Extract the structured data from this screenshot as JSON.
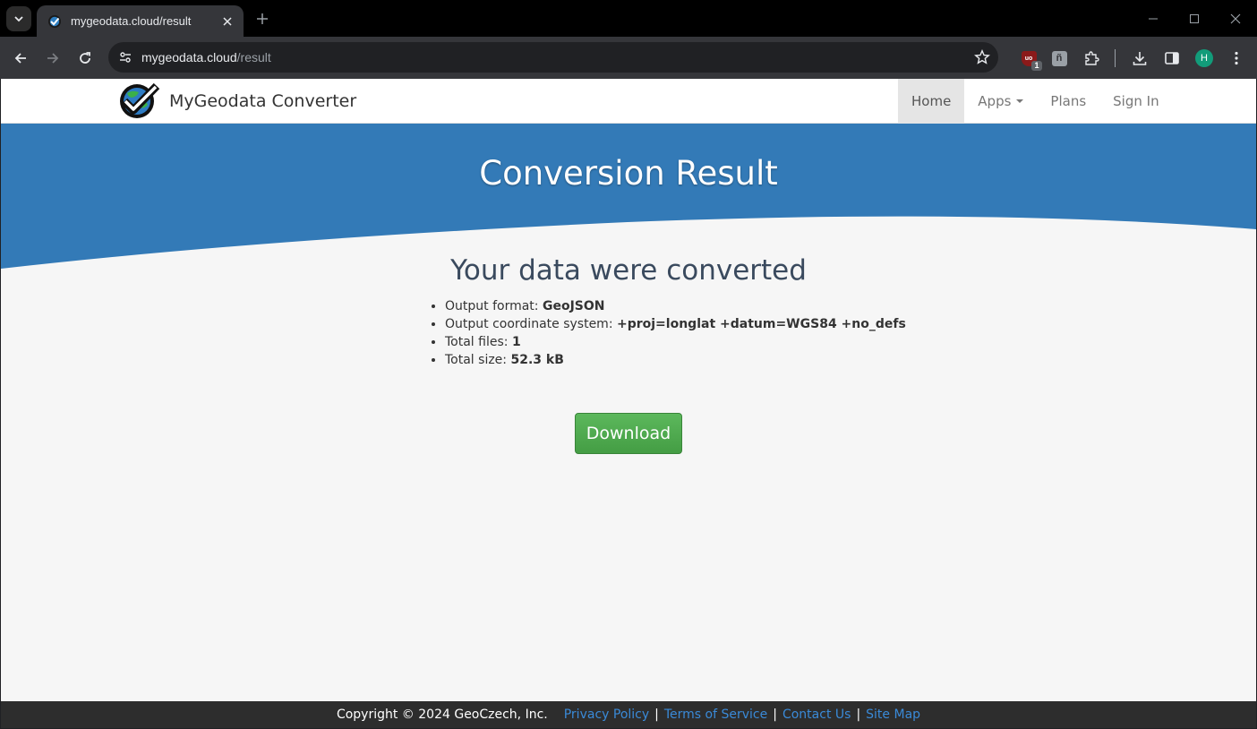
{
  "browser": {
    "tab_title": "mygeodata.cloud/result",
    "url_host": "mygeodata.cloud",
    "url_path": "/result",
    "extension_badge": "1",
    "ublock_label": "uo",
    "ext_k_label": "ñ",
    "profile_initial": "H"
  },
  "navbar": {
    "brand": "MyGeodata Converter",
    "items": [
      {
        "label": "Home"
      },
      {
        "label": "Apps"
      },
      {
        "label": "Plans"
      },
      {
        "label": "Sign In"
      }
    ]
  },
  "hero": {
    "title": "Conversion Result"
  },
  "result": {
    "heading": "Your data were converted",
    "summary": [
      {
        "label": "Output format: ",
        "value": "GeoJSON"
      },
      {
        "label": "Output coordinate system: ",
        "value": "+proj=longlat +datum=WGS84 +no_defs"
      },
      {
        "label": "Total files: ",
        "value": "1"
      },
      {
        "label": "Total size: ",
        "value": "52.3 kB"
      }
    ],
    "download_label": "Download"
  },
  "footer": {
    "copyright": "Copyright © 2024 GeoCzech, Inc.",
    "links": [
      "Privacy Policy",
      "Terms of Service",
      "Contact Us",
      "Site Map"
    ],
    "separator": "|"
  },
  "colors": {
    "hero_blue": "#337ab7",
    "page_bg": "#f6f6f6",
    "button_green": "#5cb85c",
    "footer_bg": "#2d2d2d",
    "link_blue": "#3a8ad8"
  }
}
